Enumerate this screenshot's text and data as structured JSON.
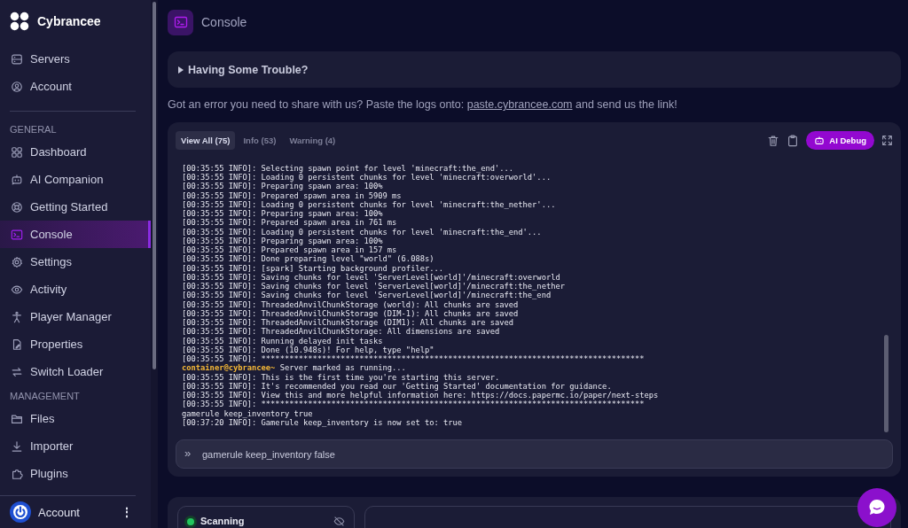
{
  "brand": {
    "name": "Cybrancee"
  },
  "sidebar": {
    "top_items": [
      {
        "label": "Servers",
        "selected": false
      },
      {
        "label": "Account",
        "selected": false
      }
    ],
    "sections": [
      {
        "heading": "GENERAL",
        "items": [
          {
            "label": "Dashboard",
            "selected": false
          },
          {
            "label": "AI Companion",
            "selected": false
          },
          {
            "label": "Getting Started",
            "selected": false
          },
          {
            "label": "Console",
            "selected": true
          },
          {
            "label": "Settings",
            "selected": false
          },
          {
            "label": "Activity",
            "selected": false
          },
          {
            "label": "Player Manager",
            "selected": false
          },
          {
            "label": "Properties",
            "selected": false
          },
          {
            "label": "Switch Loader",
            "selected": false
          }
        ]
      },
      {
        "heading": "MANAGEMENT",
        "items": [
          {
            "label": "Files",
            "selected": false
          },
          {
            "label": "Importer",
            "selected": false
          },
          {
            "label": "Plugins",
            "selected": false
          }
        ]
      }
    ],
    "account": {
      "label": "Account",
      "menu": "⋮"
    }
  },
  "page": {
    "title": "Console"
  },
  "trouble": {
    "label": "Having Some Trouble?",
    "expanded": false
  },
  "notice": {
    "before": "Got an error you need to share with us? Paste the logs onto: ",
    "link": "paste.cybrancee.com",
    "after": " and send us the link!"
  },
  "console": {
    "tabs": [
      {
        "label": "View All (75)",
        "selected": true
      },
      {
        "label": "Info (53)",
        "selected": false
      },
      {
        "label": "Warning (4)",
        "selected": false
      }
    ],
    "ai_button": "AI Debug",
    "lines": [
      {
        "kind": "log",
        "text": "[00:35:55 INFO]: Selecting spawn point for level 'minecraft:the_end'..."
      },
      {
        "kind": "log",
        "text": "[00:35:55 INFO]: Loading 0 persistent chunks for level 'minecraft:overworld'..."
      },
      {
        "kind": "log",
        "text": "[00:35:55 INFO]: Preparing spawn area: 100%"
      },
      {
        "kind": "log",
        "text": "[00:35:55 INFO]: Prepared spawn area in 5909 ms"
      },
      {
        "kind": "log",
        "text": "[00:35:55 INFO]: Loading 0 persistent chunks for level 'minecraft:the_nether'..."
      },
      {
        "kind": "log",
        "text": "[00:35:55 INFO]: Preparing spawn area: 100%"
      },
      {
        "kind": "log",
        "text": "[00:35:55 INFO]: Prepared spawn area in 761 ms"
      },
      {
        "kind": "log",
        "text": "[00:35:55 INFO]: Loading 0 persistent chunks for level 'minecraft:the_end'..."
      },
      {
        "kind": "log",
        "text": "[00:35:55 INFO]: Preparing spawn area: 100%"
      },
      {
        "kind": "log",
        "text": "[00:35:55 INFO]: Prepared spawn area in 157 ms"
      },
      {
        "kind": "log",
        "text": "[00:35:55 INFO]: Done preparing level \"world\" (6.088s)"
      },
      {
        "kind": "log",
        "text": "[00:35:55 INFO]: [spark] Starting background profiler..."
      },
      {
        "kind": "log",
        "text": "[00:35:55 INFO]: Saving chunks for level 'ServerLevel[world]'/minecraft:overworld"
      },
      {
        "kind": "log",
        "text": "[00:35:55 INFO]: Saving chunks for level 'ServerLevel[world]'/minecraft:the_nether"
      },
      {
        "kind": "log",
        "text": "[00:35:55 INFO]: Saving chunks for level 'ServerLevel[world]'/minecraft:the_end"
      },
      {
        "kind": "log",
        "text": "[00:35:55 INFO]: ThreadedAnvilChunkStorage (world): All chunks are saved"
      },
      {
        "kind": "log",
        "text": "[00:35:55 INFO]: ThreadedAnvilChunkStorage (DIM-1): All chunks are saved"
      },
      {
        "kind": "log",
        "text": "[00:35:55 INFO]: ThreadedAnvilChunkStorage (DIM1): All chunks are saved"
      },
      {
        "kind": "log",
        "text": "[00:35:55 INFO]: ThreadedAnvilChunkStorage: All dimensions are saved"
      },
      {
        "kind": "log",
        "text": "[00:35:55 INFO]: Running delayed init tasks"
      },
      {
        "kind": "log",
        "text": "[00:35:55 INFO]: Done (10.948s)! For help, type \"help\""
      },
      {
        "kind": "log",
        "text": "[00:35:55 INFO]: **********************************************************************************"
      },
      {
        "kind": "prompt",
        "prompt": "container@cybrancee~",
        "text": " Server marked as running..."
      },
      {
        "kind": "log",
        "text": "[00:35:55 INFO]: This is the first time you're starting this server."
      },
      {
        "kind": "log",
        "text": "[00:35:55 INFO]: It's recommended you read our 'Getting Started' documentation for guidance."
      },
      {
        "kind": "log",
        "text": "[00:35:55 INFO]: View this and more helpful information here: https://docs.papermc.io/paper/next-steps"
      },
      {
        "kind": "log",
        "text": "[00:35:55 INFO]: **********************************************************************************"
      },
      {
        "kind": "log",
        "text": "gamerule keep_inventory true"
      },
      {
        "kind": "log",
        "text": "[00:37:20 INFO]: Gamerule keep_inventory is now set to: true"
      }
    ],
    "input": {
      "prompt": "»",
      "value": "gamerule keep_inventory false"
    }
  },
  "status": {
    "label": "Scanning",
    "color": "#22c55e"
  }
}
